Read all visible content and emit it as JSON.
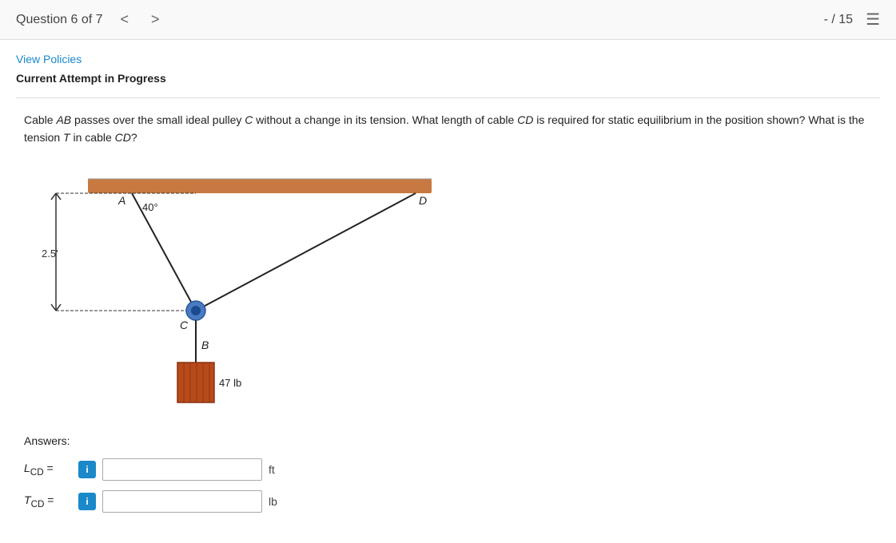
{
  "header": {
    "question_label": "Question 6 of 7",
    "nav_prev": "<",
    "nav_next": ">",
    "score": "- / 15",
    "menu_icon": "☰"
  },
  "toolbar": {
    "view_policies": "View Policies",
    "attempt_status": "Current Attempt in Progress"
  },
  "question": {
    "text_part1": "Cable ",
    "text_ab": "AB",
    "text_part2": " passes over the small ideal pulley ",
    "text_c": "C",
    "text_part3": " without a change in its tension. What length of cable ",
    "text_cd": "CD",
    "text_part4": " is required for static equilibrium in the position shown? What is the tension ",
    "text_t": "T",
    "text_part5": " in cable ",
    "text_cd2": "CD",
    "text_part6": "?"
  },
  "diagram": {
    "angle": "40°",
    "height_label": "2.5'",
    "point_a": "A",
    "point_b": "B",
    "point_c": "C",
    "point_d": "D",
    "weight": "47 lb"
  },
  "answers": {
    "label": "Answers:",
    "lcd_label": "LCD =",
    "lcd_info": "i",
    "lcd_unit": "ft",
    "lcd_placeholder": "",
    "tcd_label": "TCD =",
    "tcd_info": "i",
    "tcd_unit": "lb",
    "tcd_placeholder": ""
  }
}
